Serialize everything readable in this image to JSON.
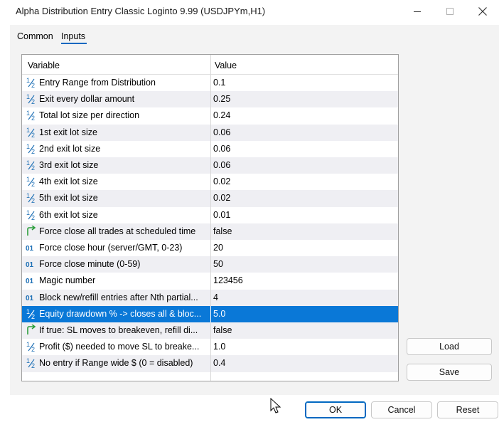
{
  "window": {
    "title": "Alpha Distribution Entry Classic Loginto 9.99 (USDJPYm,H1)"
  },
  "tabs": [
    {
      "label": "Common"
    },
    {
      "label": "Inputs"
    }
  ],
  "grid": {
    "headers": {
      "variable": "Variable",
      "value": "Value"
    },
    "rows": [
      {
        "icon": "half",
        "name": "Entry Range from Distribution",
        "value": "0.1"
      },
      {
        "icon": "half",
        "name": "Exit every dollar amount",
        "value": "0.25"
      },
      {
        "icon": "half",
        "name": "Total lot size per direction",
        "value": "0.24"
      },
      {
        "icon": "half",
        "name": "1st exit lot size",
        "value": "0.06"
      },
      {
        "icon": "half",
        "name": "2nd exit lot size",
        "value": "0.06"
      },
      {
        "icon": "half",
        "name": "3rd exit lot size",
        "value": "0.06"
      },
      {
        "icon": "half",
        "name": "4th exit lot size",
        "value": "0.02"
      },
      {
        "icon": "half",
        "name": "5th exit lot size",
        "value": "0.02"
      },
      {
        "icon": "half",
        "name": "6th exit lot size",
        "value": "0.01"
      },
      {
        "icon": "bool",
        "name": "Force close all trades at scheduled time",
        "value": "false"
      },
      {
        "icon": "int",
        "name": "Force close hour (server/GMT, 0-23)",
        "value": "20"
      },
      {
        "icon": "int",
        "name": "Force close minute (0-59)",
        "value": "50"
      },
      {
        "icon": "int",
        "name": "Magic number",
        "value": "123456"
      },
      {
        "icon": "int",
        "name": "Block new/refill entries after Nth partial...",
        "value": "4"
      },
      {
        "icon": "half",
        "name": "Equity drawdown % -> closes all & bloc...",
        "value": "5.0"
      },
      {
        "icon": "bool",
        "name": "If true: SL moves to breakeven, refill di...",
        "value": "false"
      },
      {
        "icon": "half",
        "name": "Profit ($) needed to move SL to breake...",
        "value": "1.0"
      },
      {
        "icon": "half",
        "name": "No entry if Range wide $ (0 = disabled)",
        "value": "0.4"
      }
    ]
  },
  "buttons": {
    "load": "Load",
    "save": "Save",
    "ok": "OK",
    "cancel": "Cancel",
    "reset": "Reset"
  },
  "icons": {
    "half": "1/2",
    "int": "01",
    "bool": "↗"
  },
  "colors": {
    "accent": "#0067c0",
    "selected_row": "#0a78d7",
    "icon_blue": "#1c6fb5",
    "icon_green": "#2a9d3a"
  }
}
